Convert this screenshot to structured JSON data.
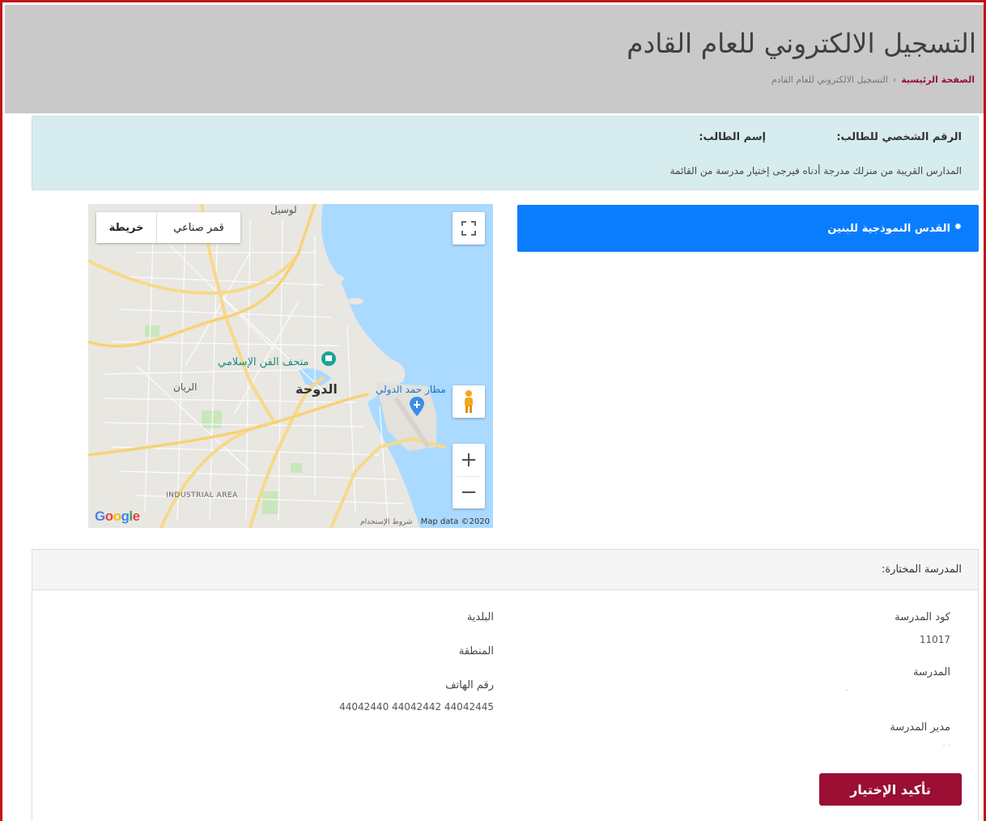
{
  "header": {
    "title": "التسجيل الالكتروني للعام القادم",
    "breadcrumb_home": "الصفحة الرئيسية",
    "breadcrumb_separator": "›",
    "breadcrumb_current": "التسجيل الالكتروني للعام القادم"
  },
  "info": {
    "student_id_label": "الرقم الشخصي للطالب:",
    "student_name_label": "إسم الطالب:",
    "note": "المدارس القريبة من منزلك مدرجة أدناه فيرجى إختيار مدرسة من القائمة"
  },
  "schools": [
    {
      "label": "القدس النموذجية للبنين",
      "selected": true
    }
  ],
  "map": {
    "type_satellite": "قمر صناعي",
    "type_map": "خريطة",
    "zoom_in": "+",
    "zoom_out": "−",
    "logo": "Google",
    "data_credit": "Map data ©2020",
    "terms": "شروط الإستخدام",
    "labels": {
      "lusail": "لوسيل",
      "museum": "متحف الفن الإسلامي",
      "doha": "الدوحة",
      "rayyan": "الريان",
      "airport": "مطار حمد الدولي",
      "industrial": "INDUSTRIAL AREA"
    }
  },
  "selected_school": {
    "heading": "المدرسة المختارة:",
    "code_label": "كود المدرسة",
    "code_value": "11017",
    "school_label": "المدرسة",
    "principal_label": "مدير المدرسة",
    "municipality_label": "البلدية",
    "area_label": "المنطقة",
    "phone_label": "رقم الهاتف",
    "phone_value": "44042440 44042442 44042445",
    "confirm_label": "تأكيد الإختيار"
  },
  "colors": {
    "accent_blue": "#0a7dff",
    "confirm_red": "#9a0f33",
    "frame_red": "#c0121b",
    "header_gray": "#c9c9c9",
    "info_bg": "#d7ecef"
  }
}
